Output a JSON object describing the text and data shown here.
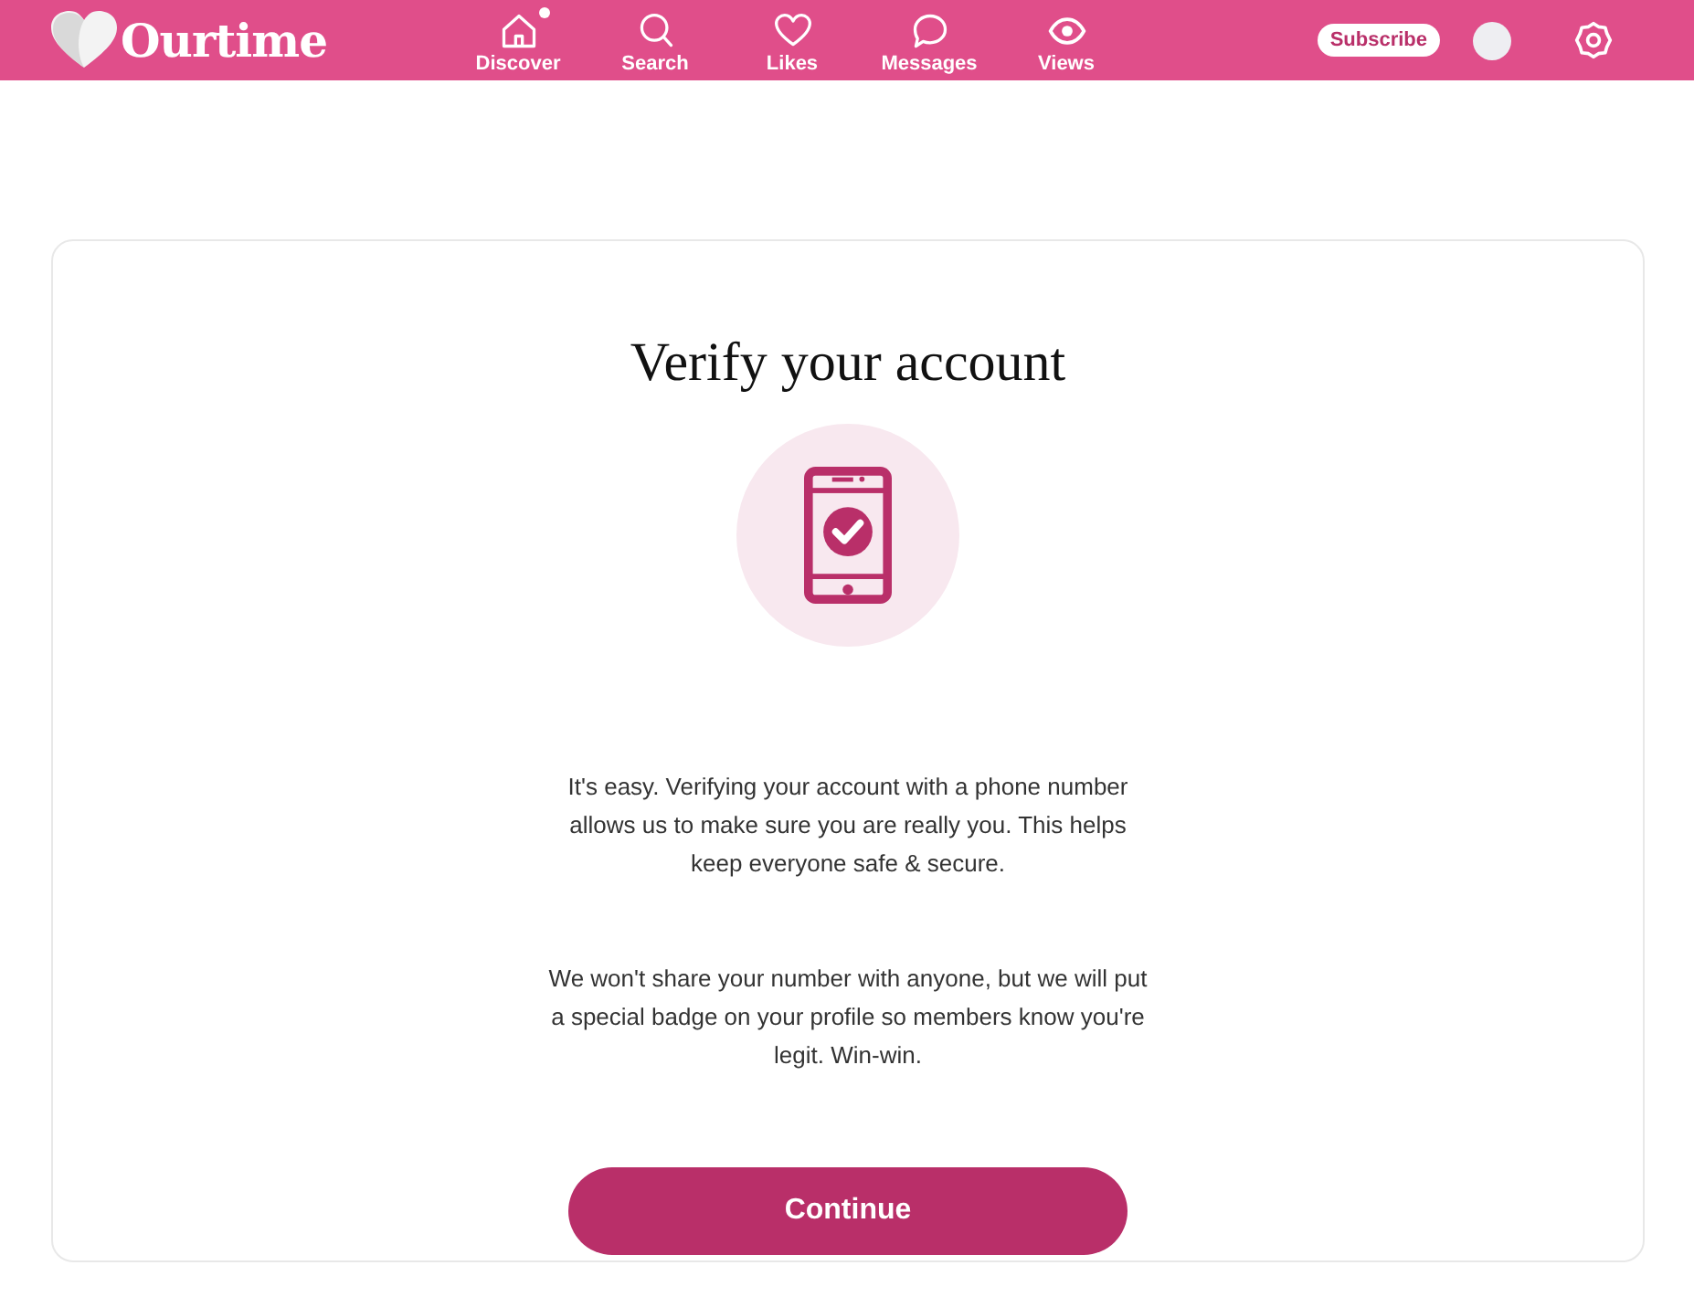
{
  "header": {
    "logo": "Ourtime",
    "nav": [
      {
        "label": "Discover",
        "kind": "home",
        "badge": true
      },
      {
        "label": "Search",
        "kind": "search",
        "badge": false
      },
      {
        "label": "Likes",
        "kind": "heart",
        "badge": false
      },
      {
        "label": "Messages",
        "kind": "chat",
        "badge": false
      },
      {
        "label": "Views",
        "kind": "eye",
        "badge": false
      }
    ],
    "subscribe": "Subscribe"
  },
  "card": {
    "title": "Verify your account",
    "paragraphs": [
      "It's easy. Verifying your account with a phone number allows us to make sure you are really you. This helps keep everyone safe & secure.",
      "We won't share your number with anyone, but we will put a special badge on your profile so members know you're legit. Win-win."
    ],
    "button": "Continue"
  }
}
